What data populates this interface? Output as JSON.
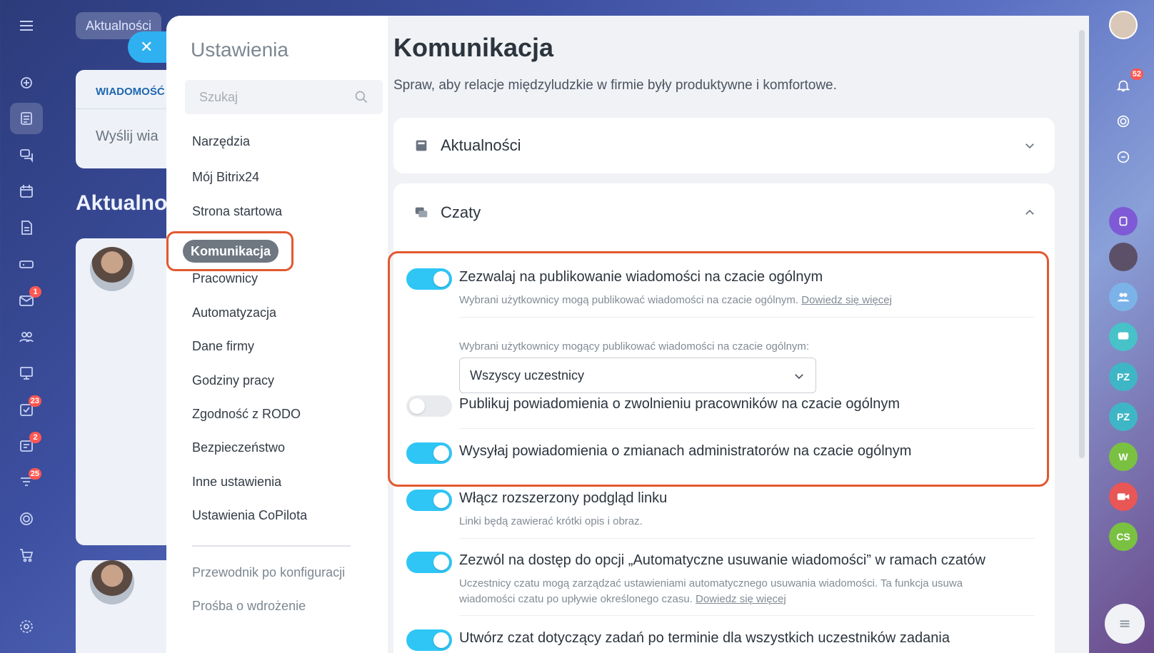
{
  "background": {
    "tab_label": "Aktualności",
    "post_tab": "WIADOMOŚĆ",
    "post_placeholder": "Wyślij wia",
    "heading": "Aktualno"
  },
  "left_rail": {
    "badges": {
      "mail": "1",
      "tasks": "23",
      "feed2": "2",
      "filters": "25"
    }
  },
  "right_rail": {
    "notifications_badge": "52",
    "avatars": [
      "PZ",
      "PZ",
      "W",
      "CS"
    ]
  },
  "settings_nav": {
    "title": "Ustawienia",
    "search_placeholder": "Szukaj",
    "items": [
      "Narzędzia",
      "Mój Bitrix24",
      "Strona startowa",
      "Komunikacja",
      "Pracownicy",
      "Automatyzacja",
      "Dane firmy",
      "Godziny pracy",
      "Zgodność z RODO",
      "Bezpieczeństwo",
      "Inne ustawienia",
      "Ustawienia CoPilota"
    ],
    "footer_items": [
      "Przewodnik po konfiguracji",
      "Prośba o wdrożenie"
    ]
  },
  "content": {
    "title": "Komunikacja",
    "subtitle": "Spraw, aby relacje międzyludzkie w firmie były produktywne i komfortowe.",
    "section_feed": "Aktualności",
    "section_chats": "Czaty",
    "settings": [
      {
        "label": "Zezwalaj na publikowanie wiadomości na czacie ogólnym",
        "desc": "Wybrani użytkownicy mogą publikować wiadomości na czacie ogólnym.",
        "link": "Dowiedz się więcej",
        "on": true
      },
      {
        "label": "Publikuj powiadomienia o zwolnieniu pracowników na czacie ogólnym",
        "on": false
      },
      {
        "label": "Wysyłaj powiadomienia o zmianach administratorów na czacie ogólnym",
        "on": true
      },
      {
        "label": "Włącz rozszerzony podgląd linku",
        "desc": "Linki będą zawierać krótki opis i obraz.",
        "on": true
      },
      {
        "label": "Zezwól na dostęp do opcji „Automatyczne usuwanie wiadomości” w ramach czatów",
        "desc": "Uczestnicy czatu mogą zarządzać ustawieniami automatycznego usuwania wiadomości. Ta funkcja usuwa wiadomości czatu po upływie określonego czasu.",
        "link": "Dowiedz się więcej",
        "on": true
      },
      {
        "label": "Utwórz czat dotyczący zadań po terminie dla wszystkich uczestników zadania",
        "on": true
      }
    ],
    "select_label": "Wybrani użytkownicy mogący publikować wiadomości na czacie ogólnym:",
    "select_value": "Wszyscy uczestnicy"
  }
}
